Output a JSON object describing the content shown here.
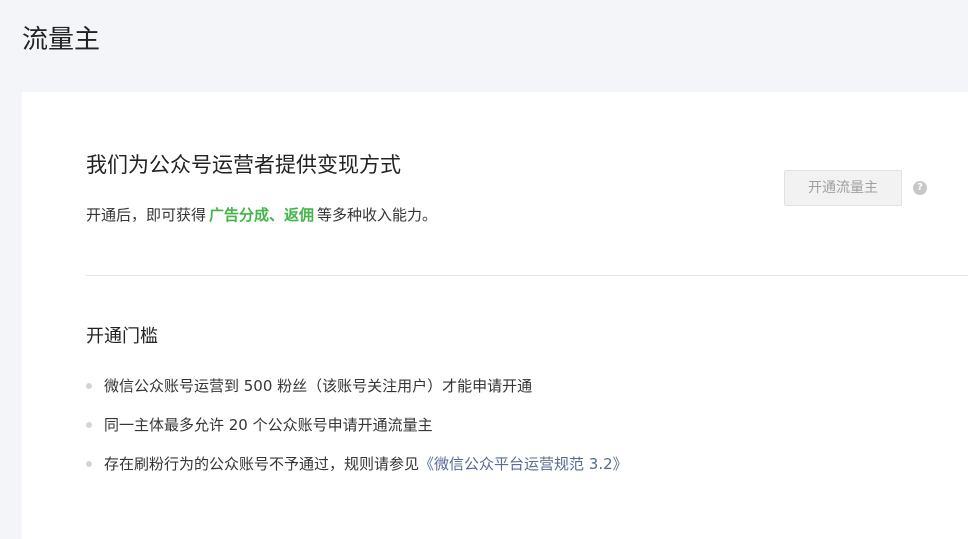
{
  "page": {
    "title": "流量主"
  },
  "hero": {
    "title": "我们为公众号运营者提供变现方式",
    "desc_prefix": "开通后，即可获得",
    "desc_highlight": "广告分成、返佣",
    "desc_suffix": "等多种收入能力。",
    "open_button_label": "开通流量主",
    "help_icon": "question-mark-icon",
    "help_glyph": "?"
  },
  "requirements": {
    "title": "开通门槛",
    "items": [
      {
        "text": "微信公众账号运营到 500 粉丝（该账号关注用户）才能申请开通"
      },
      {
        "text": "同一主体最多允许 20 个公众账号申请开通流量主"
      },
      {
        "text": "存在刷粉行为的公众账号不予通过，规则请参见",
        "link": "《微信公众平台运营规范 3.2》"
      }
    ]
  },
  "colors": {
    "highlight": "#44b549",
    "link": "#576b95",
    "background": "#f4f5f9",
    "card": "#ffffff"
  }
}
